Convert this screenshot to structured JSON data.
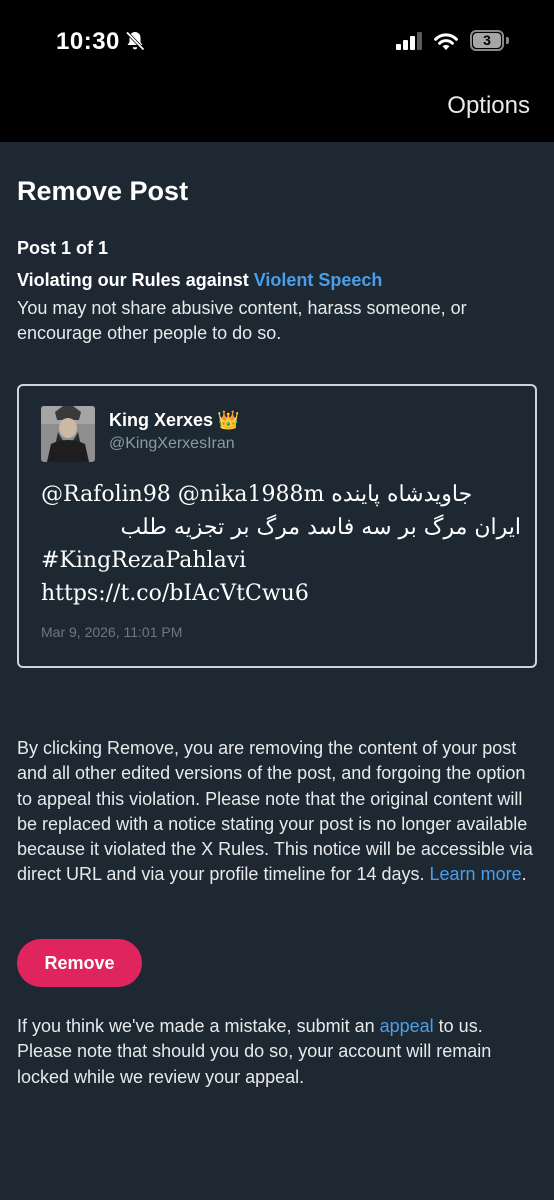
{
  "status_bar": {
    "time": "10:30",
    "battery_level": "3",
    "icons": [
      "bell-slash-icon",
      "signal-icon",
      "wifi-icon",
      "battery-icon"
    ]
  },
  "header": {
    "options_label": "Options"
  },
  "page": {
    "title": "Remove Post",
    "post_count": "Post 1 of 1",
    "violation_prefix": "Violating our Rules against ",
    "violation_link": "Violent Speech",
    "violation_description": "You may not share abusive content, harass someone, or encourage other people to do so."
  },
  "tweet": {
    "author_name": "King Xerxes",
    "author_badge": "👑",
    "author_handle": "@KingXerxesIran",
    "lines": [
      "@Rafolin98 @nika1988m جاویدشاه پاینده",
      "ایران مرگ بر سه فاسد مرگ بر تجزیه طلب",
      "#KingRezaPahlavi",
      "https://t.co/bIAcVtCwu6"
    ],
    "timestamp": "Mar 9, 2026, 11:01 PM"
  },
  "explanation": {
    "text": "By clicking Remove, you are removing the content of your post and all other edited versions of the post, and forgoing the option to appeal this violation. Please note that the original content will be replaced with a notice stating your post is no longer available because it violated the X Rules. This notice will be accessible via direct URL and via your profile timeline for 14 days. ",
    "learn_more": "Learn more",
    "trailing": "."
  },
  "actions": {
    "remove_label": "Remove"
  },
  "footer": {
    "prefix": "If you think we've made a mistake, submit an ",
    "appeal_link": "appeal",
    "suffix": " to us. Please note that should you do so, your account will remain locked while we review your appeal."
  },
  "colors": {
    "background": "#1e2833",
    "top_bar": "#000000",
    "link": "#4b9ee8",
    "remove_button": "#e0245e"
  }
}
